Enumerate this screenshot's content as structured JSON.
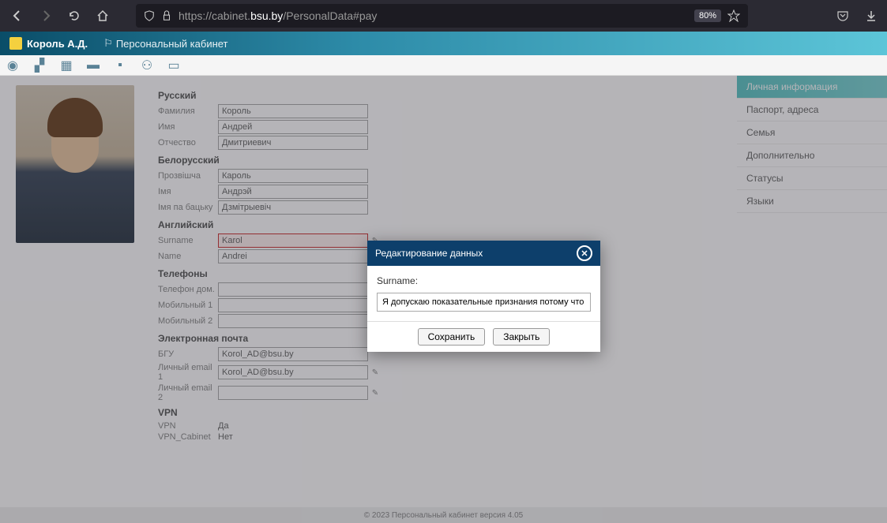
{
  "browser": {
    "url_prefix": "https://cabinet.",
    "url_domain": "bsu.by",
    "url_path": "/PersonalData#pay",
    "zoom": "80%"
  },
  "header": {
    "user_name": "Король А.Д.",
    "nav_label": "Персональный кабинет"
  },
  "sidebar": {
    "items": [
      {
        "label": "Личная информация"
      },
      {
        "label": "Паспорт, адреса"
      },
      {
        "label": "Семья"
      },
      {
        "label": "Дополнительно"
      },
      {
        "label": "Статусы"
      },
      {
        "label": "Языки"
      }
    ]
  },
  "form": {
    "russian": {
      "title": "Русский",
      "surname_label": "Фамилия",
      "surname_value": "Король",
      "name_label": "Имя",
      "name_value": "Андрей",
      "patronymic_label": "Отчество",
      "patronymic_value": "Дмитриевич"
    },
    "belarusian": {
      "title": "Белорусский",
      "surname_label": "Прозвішча",
      "surname_value": "Кароль",
      "name_label": "Імя",
      "name_value": "Андрэй",
      "patronymic_label": "Імя па бацьку",
      "patronymic_value": "Дзмітрыевіч"
    },
    "english": {
      "title": "Английский",
      "surname_label": "Surname",
      "surname_value": "Karol",
      "name_label": "Name",
      "name_value": "Andrei"
    },
    "phones": {
      "title": "Телефоны",
      "home_label": "Телефон дом.",
      "home_value": "",
      "mobile1_label": "Мобильный 1",
      "mobile1_value": "",
      "mobile2_label": "Мобильный 2",
      "mobile2_value": ""
    },
    "email": {
      "title": "Электронная почта",
      "bsu_label": "БГУ",
      "bsu_value": "Korol_AD@bsu.by",
      "personal1_label": "Личный email 1",
      "personal1_value": "Korol_AD@bsu.by",
      "personal2_label": "Личный email 2",
      "personal2_value": ""
    },
    "vpn": {
      "title": "VPN",
      "vpn_label": "VPN",
      "vpn_value": "Да",
      "cabinet_label": "VPN_Cabinet",
      "cabinet_value": "Нет"
    }
  },
  "modal": {
    "title": "Редактирование данных",
    "field_label": "Surname:",
    "field_value": "Я допускаю показательные признания потому что фашист",
    "save_label": "Сохранить",
    "close_label": "Закрыть"
  },
  "footer": {
    "left": "",
    "center": "© 2023 Персональный кабинет версия 4.05"
  }
}
